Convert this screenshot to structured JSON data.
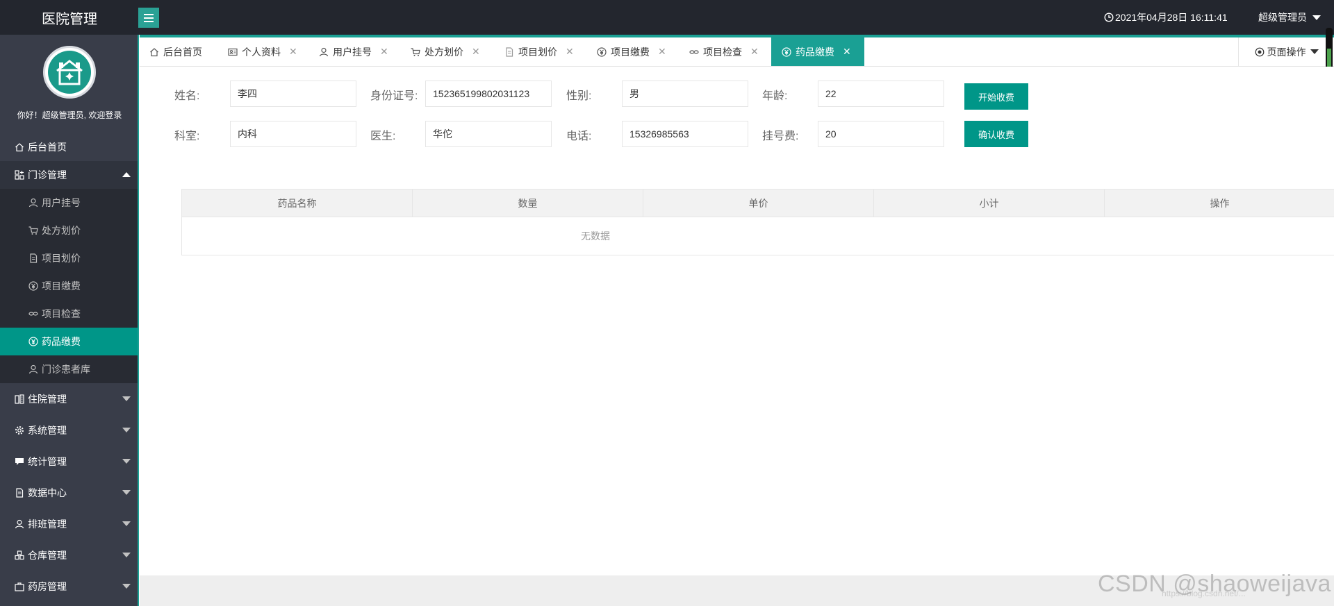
{
  "app": {
    "title": "医院管理"
  },
  "header": {
    "datetime": "2021年04月28日 16:11:41",
    "user": "超级管理员"
  },
  "sidebar": {
    "welcome": "你好！超级管理员, 欢迎登录",
    "home": {
      "label": "后台首页",
      "icon": "home-icon"
    },
    "outpatient": {
      "label": "门诊管理",
      "icon": "grid-plus-icon",
      "items": [
        {
          "label": "用户挂号",
          "icon": "user-icon"
        },
        {
          "label": "处方划价",
          "icon": "cart-icon"
        },
        {
          "label": "项目划价",
          "icon": "document-icon"
        },
        {
          "label": "项目缴费",
          "icon": "yen-icon"
        },
        {
          "label": "项目检查",
          "icon": "link-icon"
        },
        {
          "label": "药品缴费",
          "icon": "yen-icon"
        },
        {
          "label": "门诊患者库",
          "icon": "user-icon"
        }
      ]
    },
    "groups": [
      {
        "label": "住院管理",
        "icon": "building-icon"
      },
      {
        "label": "系统管理",
        "icon": "gear-icon"
      },
      {
        "label": "统计管理",
        "icon": "chat-icon"
      },
      {
        "label": "数据中心",
        "icon": "document-icon"
      },
      {
        "label": "排班管理",
        "icon": "user-icon"
      },
      {
        "label": "仓库管理",
        "icon": "warehouse-icon"
      },
      {
        "label": "药房管理",
        "icon": "pharmacy-icon"
      }
    ]
  },
  "tabs": {
    "items": [
      {
        "label": "后台首页",
        "icon": "home-icon",
        "closable": false
      },
      {
        "label": "个人资料",
        "icon": "id-card-icon",
        "closable": true
      },
      {
        "label": "用户挂号",
        "icon": "user-icon",
        "closable": true
      },
      {
        "label": "处方划价",
        "icon": "cart-icon",
        "closable": true
      },
      {
        "label": "项目划价",
        "icon": "document-icon",
        "closable": true
      },
      {
        "label": "项目缴费",
        "icon": "yen-icon",
        "closable": true
      },
      {
        "label": "项目检查",
        "icon": "link-icon",
        "closable": true
      },
      {
        "label": "药品缴费",
        "icon": "yen-icon",
        "closable": true
      }
    ],
    "close_glyph": "✕",
    "page_ops": "页面操作"
  },
  "form": {
    "name": {
      "label": "姓名:",
      "value": "李四"
    },
    "id_number": {
      "label": "身份证号:",
      "value": "152365199802031123"
    },
    "gender": {
      "label": "性别:",
      "value": "男"
    },
    "age": {
      "label": "年龄:",
      "value": "22"
    },
    "department": {
      "label": "科室:",
      "value": "内科"
    },
    "doctor": {
      "label": "医生:",
      "value": "华佗"
    },
    "phone": {
      "label": "电话:",
      "value": "15326985563"
    },
    "reg_fee": {
      "label": "挂号费:",
      "value": "20"
    },
    "start_button": "开始收费",
    "confirm_button": "确认收费"
  },
  "table": {
    "columns": [
      "药品名称",
      "数量",
      "单价",
      "小计",
      "操作"
    ],
    "empty_text": "无数据"
  },
  "watermark": {
    "text": "CSDN @shaoweijava",
    "sub": "https://blog.csdn.net/..."
  },
  "colors": {
    "accent": "#009688",
    "header_bg": "#23262e",
    "sidebar_bg": "#393d49"
  }
}
